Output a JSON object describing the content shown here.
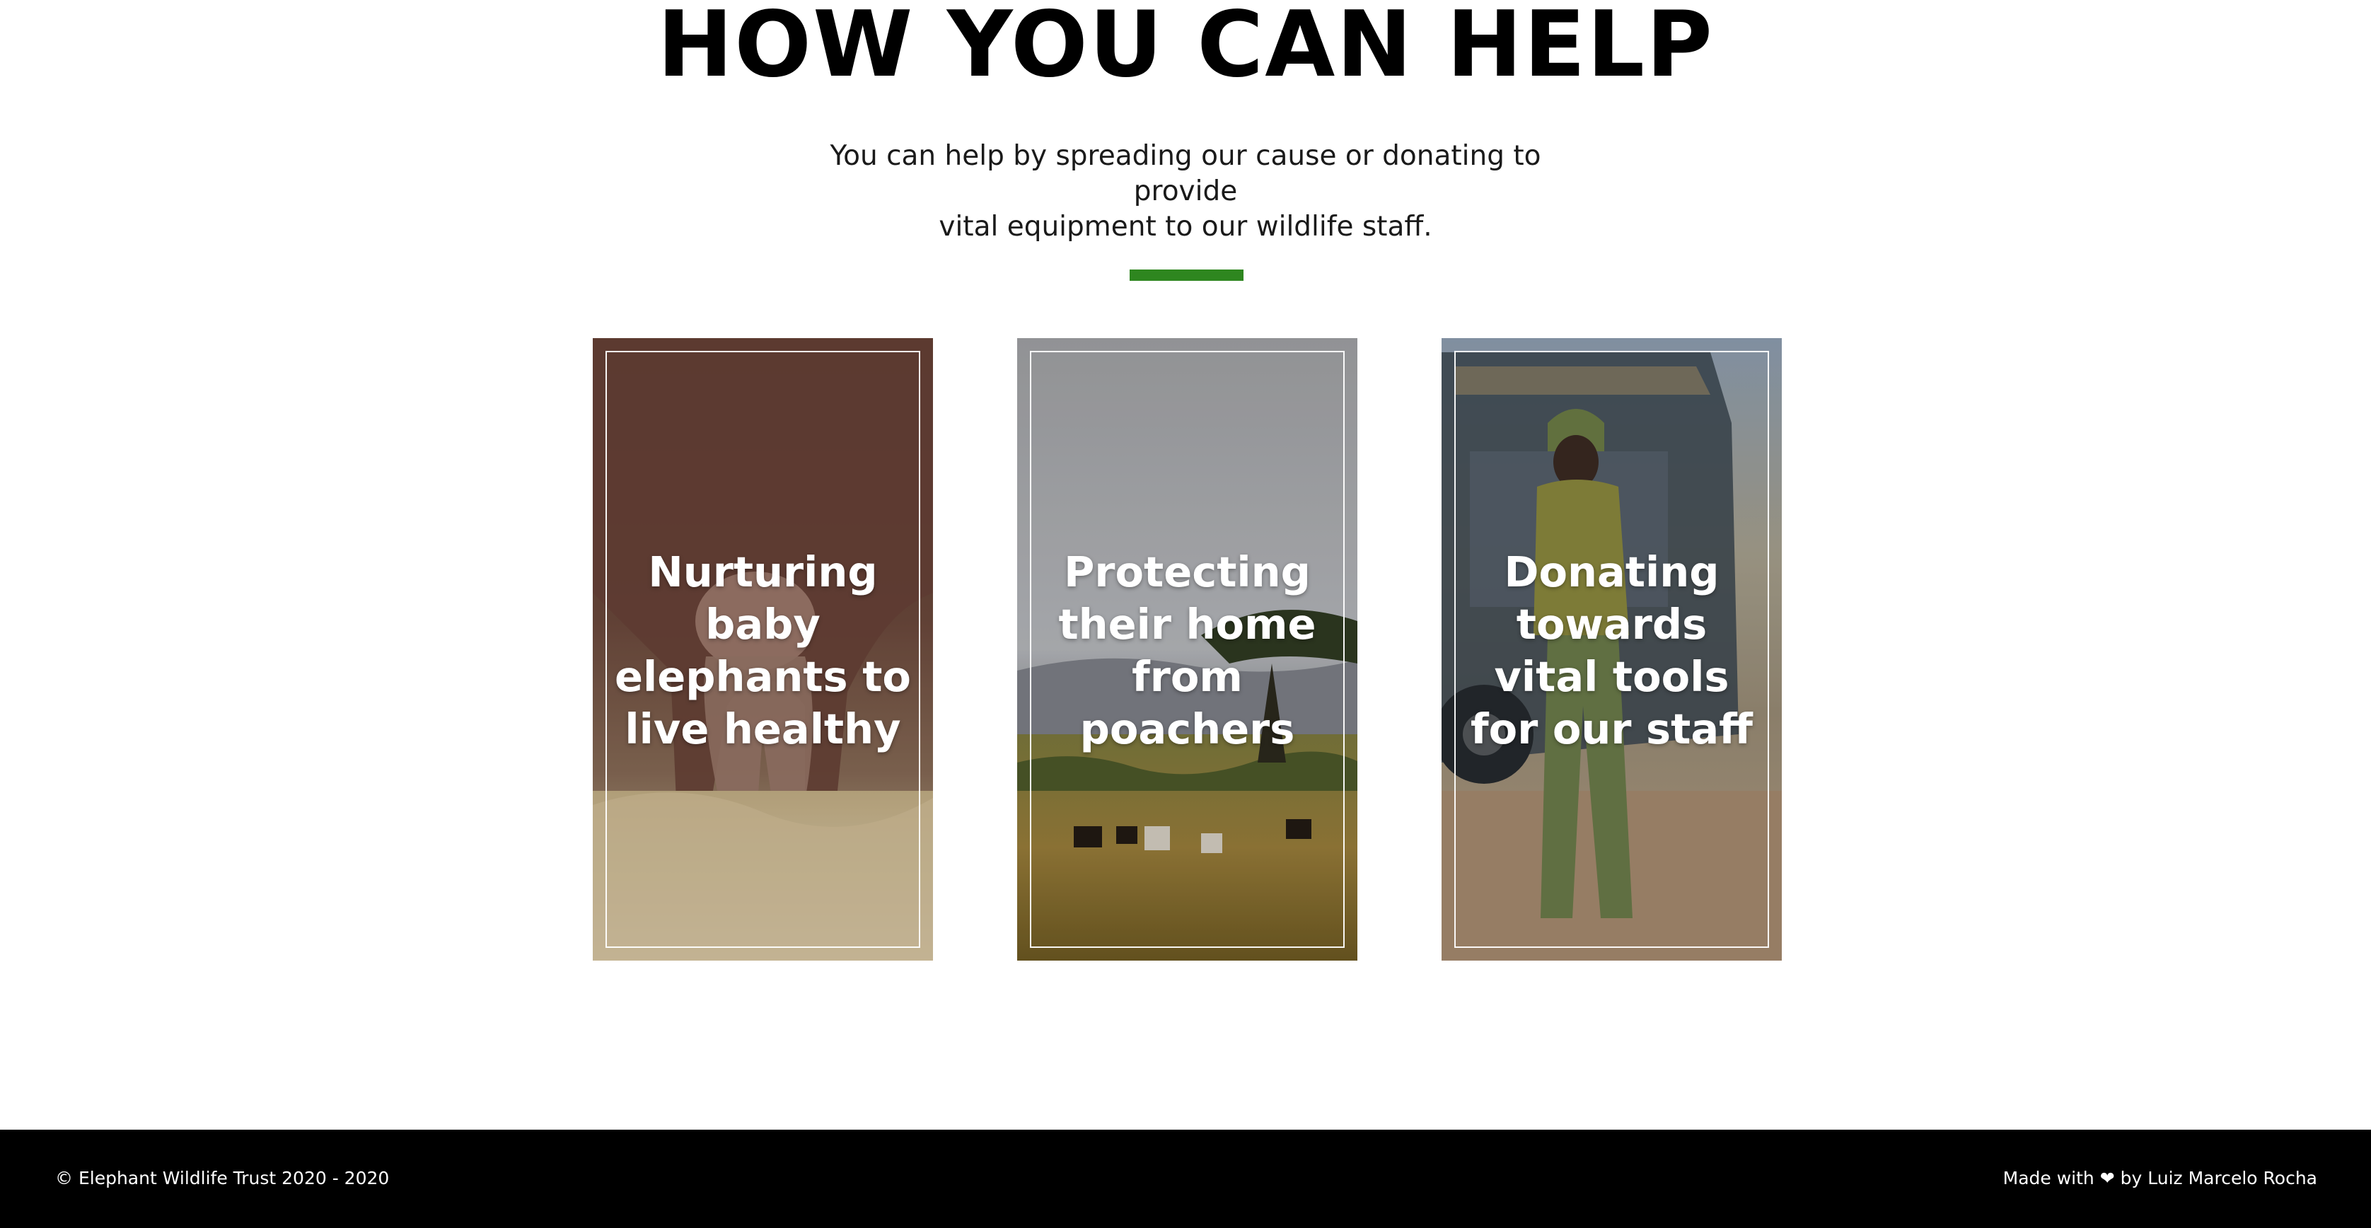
{
  "section": {
    "title": "HOW YOU CAN HELP",
    "intro_lines": [
      "You can help by spreading our cause or donating to provide",
      "vital equipment to our wildlife staff."
    ],
    "accent_color": "#2e861f"
  },
  "cards": [
    {
      "title_lines": [
        "Nurturing",
        "baby",
        "elephants to",
        "live healthy"
      ],
      "image": "baby-elephant-photo"
    },
    {
      "title_lines": [
        "Protecting",
        "their home",
        "from",
        "poachers"
      ],
      "image": "savanna-zebras-photo"
    },
    {
      "title_lines": [
        "Donating",
        "towards",
        "vital tools",
        "for our staff"
      ],
      "image": "ranger-and-jeep-photo"
    }
  ],
  "footer": {
    "copyright": "© Elephant Wildlife Trust 2020 - 2020",
    "made_with_prefix": "Made with",
    "heart_icon": "heart-icon",
    "heart_glyph": "❤",
    "made_with_suffix": "by Luiz Marcelo Rocha"
  }
}
